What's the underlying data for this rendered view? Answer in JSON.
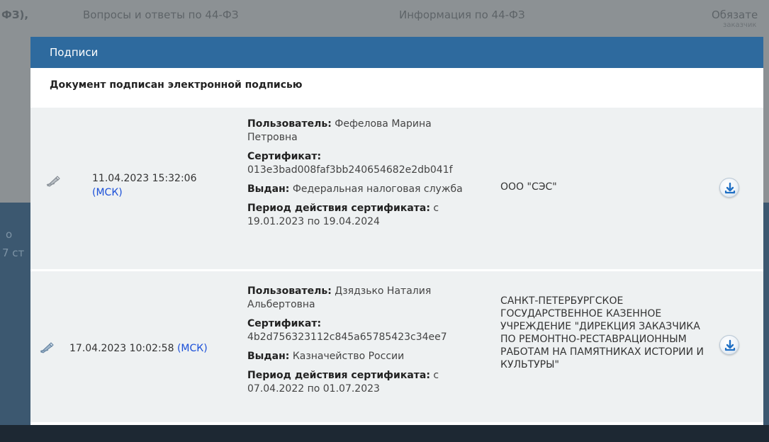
{
  "background": {
    "nav": [
      {
        "label": "ФЗ),"
      },
      {
        "label": "Вопросы и ответы по 44-ФЗ"
      },
      {
        "label": "Информация по 44-ФЗ"
      },
      {
        "label": "Обязате"
      }
    ],
    "nav_sub": "заказчик",
    "side": [
      "о",
      "7 ст"
    ]
  },
  "modal": {
    "title": "Подписи",
    "subtitle": "Документ подписан электронной подписью",
    "labels": {
      "user": "Пользователь:",
      "certificate": "Сертификат:",
      "issued": "Выдан:",
      "validity": "Период действия сертификата:"
    },
    "signatures": [
      {
        "date": "11.04.2023 15:32:06",
        "timezone": "(МСК)",
        "user": "Фефелова Марина Петровна",
        "certificate": "013e3bad008faf3bb240654682e2db041f",
        "issued": "Федеральная налоговая служба",
        "validity_prefix": "с",
        "validity": "19.01.2023 по 19.04.2024",
        "organization": "ООО \"СЭС\""
      },
      {
        "date": "17.04.2023 10:02:58",
        "timezone": "(МСК)",
        "user": "Дзядзько Наталия Альбертовна",
        "certificate": "4b2d756323112c845a65785423c34ee7",
        "issued": "Казначейство России",
        "validity_prefix": "с",
        "validity": "07.04.2022 по 01.07.2023",
        "organization": "САНКТ-ПЕТЕРБУРГСКОЕ ГОСУДАРСТВЕННОЕ КАЗЕННОЕ УЧРЕЖДЕНИЕ \"ДИРЕКЦИЯ ЗАКАЗЧИКА ПО РЕМОНТНО-РЕСТАВРАЦИОННЫМ РАБОТАМ НА ПАМЯТНИКАХ ИСТОРИИ И КУЛЬТУРЫ\""
      }
    ]
  },
  "colors": {
    "header": "#2e6a9e",
    "row_bg": "#eef1f2",
    "timezone_link": "#1a4fd8"
  },
  "icons": {
    "signature": "signature-pen-icon",
    "download": "download-icon"
  }
}
